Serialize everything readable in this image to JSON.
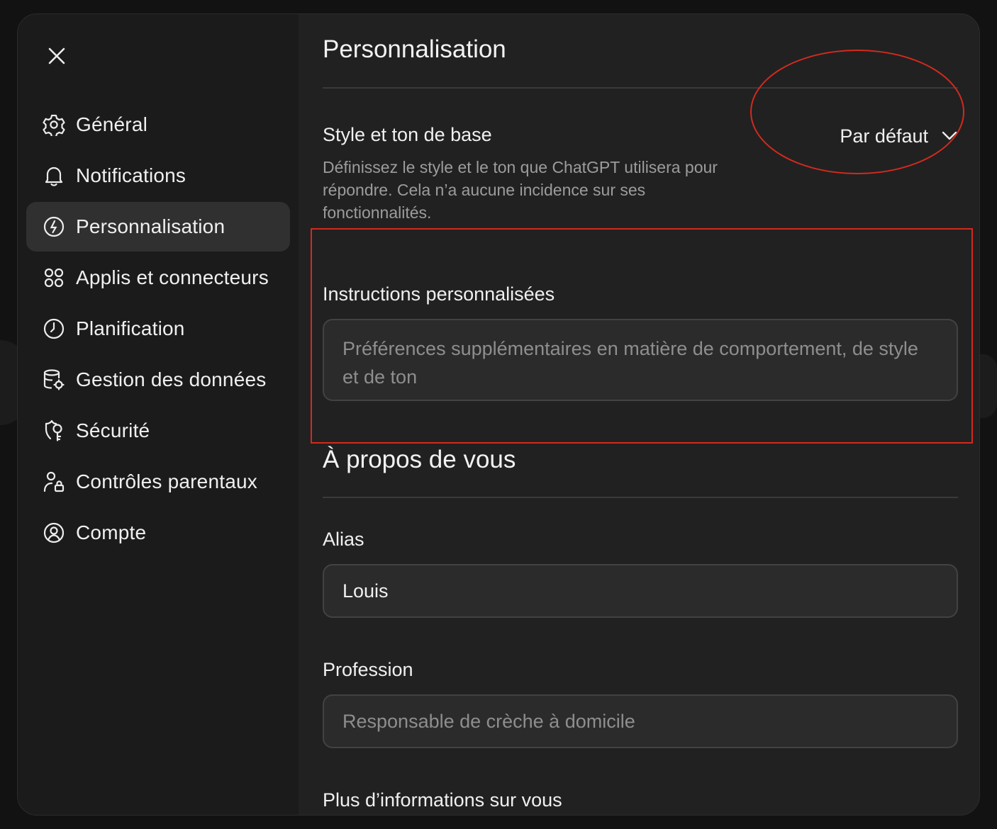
{
  "sidebar": {
    "close_icon": "close-icon",
    "items": [
      {
        "label": "Général",
        "icon": "gear-icon",
        "active": false
      },
      {
        "label": "Notifications",
        "icon": "bell-icon",
        "active": false
      },
      {
        "label": "Personnalisation",
        "icon": "personalization-icon",
        "active": true
      },
      {
        "label": "Applis et connecteurs",
        "icon": "apps-icon",
        "active": false
      },
      {
        "label": "Planification",
        "icon": "clock-icon",
        "active": false
      },
      {
        "label": "Gestion des données",
        "icon": "database-gear-icon",
        "active": false
      },
      {
        "label": "Sécurité",
        "icon": "shield-key-icon",
        "active": false
      },
      {
        "label": "Contrôles parentaux",
        "icon": "parental-controls-icon",
        "active": false
      },
      {
        "label": "Compte",
        "icon": "account-icon",
        "active": false
      }
    ]
  },
  "main": {
    "title": "Personnalisation",
    "style": {
      "label": "Style et ton de base",
      "description": "Définissez le style et le ton que ChatGPT utilisera pour répondre. Cela n’a aucune incidence sur ses fonctionnalités.",
      "dropdown_value": "Par défaut"
    },
    "custom_instructions": {
      "label": "Instructions personnalisées",
      "placeholder": "Préférences supplémentaires en matière de comportement, de style et de ton"
    },
    "about": {
      "title": "À propos de vous",
      "alias_label": "Alias",
      "alias_value": "Louis",
      "profession_label": "Profession",
      "profession_placeholder": "Responsable de crèche à domicile",
      "more_label": "Plus d’informations sur vous"
    }
  },
  "colors": {
    "background": "#121212",
    "modal": "#212121",
    "sidebar": "#1b1b1b",
    "active_item": "#303030",
    "field": "#2b2b2b",
    "annotation": "#d42a1e"
  }
}
